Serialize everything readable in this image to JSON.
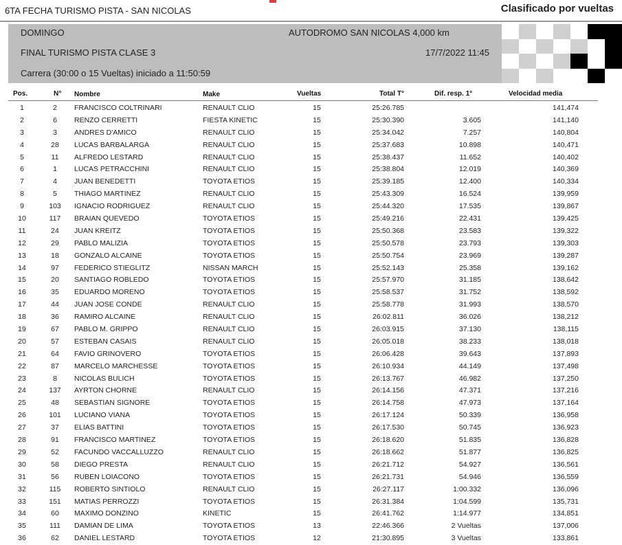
{
  "header": {
    "event_title": "6TA FECHA TURISMO PISTA - SAN NICOLAS",
    "classification": "Clasificado por vueltas"
  },
  "info": {
    "day": "DOMINGO",
    "circuit": "AUTODROMO SAN NICOLAS 4,000 km",
    "session": "FINAL TURISMO PISTA CLASE 3",
    "datetime": "17/7/2022 11:45",
    "race_start": "Carrera (30:00 o 15 Vueltas) iniciado a 11:50:59"
  },
  "columns": {
    "pos": "Pos.",
    "num": "N°",
    "name": "Nombre",
    "make": "Make",
    "laps": "Vueltas",
    "total": "Total T°",
    "diff": "Dif. resp. 1°",
    "speed": "Velocidad media"
  },
  "rows": [
    {
      "pos": "1",
      "num": "2",
      "name": "FRANCISCO COLTRINARI",
      "make": "RENAULT CLIO",
      "laps": "15",
      "total": "25:26.785",
      "diff": "",
      "speed": "141,474"
    },
    {
      "pos": "2",
      "num": "6",
      "name": "RENZO CERRETTI",
      "make": "FIESTA KINETIC",
      "laps": "15",
      "total": "25:30.390",
      "diff": "3.605",
      "speed": "141,140"
    },
    {
      "pos": "3",
      "num": "3",
      "name": "ANDRES D'AMICO",
      "make": "RENAULT CLIO",
      "laps": "15",
      "total": "25:34.042",
      "diff": "7.257",
      "speed": "140,804"
    },
    {
      "pos": "4",
      "num": "28",
      "name": "LUCAS BARBALARGA",
      "make": "RENAULT CLIO",
      "laps": "15",
      "total": "25:37.683",
      "diff": "10.898",
      "speed": "140,471"
    },
    {
      "pos": "5",
      "num": "11",
      "name": "ALFREDO LESTARD",
      "make": "RENAULT CLIO",
      "laps": "15",
      "total": "25:38.437",
      "diff": "11.652",
      "speed": "140,402"
    },
    {
      "pos": "6",
      "num": "1",
      "name": "LUCAS PETRACCHINI",
      "make": "RENAULT CLIO",
      "laps": "15",
      "total": "25:38.804",
      "diff": "12.019",
      "speed": "140,369"
    },
    {
      "pos": "7",
      "num": "4",
      "name": "JUAN BENEDETTI",
      "make": "TOYOTA ETIOS",
      "laps": "15",
      "total": "25:39.185",
      "diff": "12.400",
      "speed": "140,334"
    },
    {
      "pos": "8",
      "num": "5",
      "name": "THIAGO MARTINEZ",
      "make": "RENAULT CLIO",
      "laps": "15",
      "total": "25:43.309",
      "diff": "16.524",
      "speed": "139,959"
    },
    {
      "pos": "9",
      "num": "103",
      "name": "IGNACIO RODRIGUEZ",
      "make": "RENAULT CLIO",
      "laps": "15",
      "total": "25:44.320",
      "diff": "17.535",
      "speed": "139,867"
    },
    {
      "pos": "10",
      "num": "117",
      "name": "BRAIAN QUEVEDO",
      "make": "TOYOTA ETIOS",
      "laps": "15",
      "total": "25:49.216",
      "diff": "22.431",
      "speed": "139,425"
    },
    {
      "pos": "11",
      "num": "24",
      "name": "JUAN KREITZ",
      "make": "TOYOTA ETIOS",
      "laps": "15",
      "total": "25:50.368",
      "diff": "23.583",
      "speed": "139,322"
    },
    {
      "pos": "12",
      "num": "29",
      "name": "PABLO MALIZIA",
      "make": "TOYOTA ETIOS",
      "laps": "15",
      "total": "25:50.578",
      "diff": "23.793",
      "speed": "139,303"
    },
    {
      "pos": "13",
      "num": "18",
      "name": "GONZALO ALCAINE",
      "make": "TOYOTA ETIOS",
      "laps": "15",
      "total": "25:50.754",
      "diff": "23.969",
      "speed": "139,287"
    },
    {
      "pos": "14",
      "num": "97",
      "name": "FEDERICO STIEGLITZ",
      "make": "NISSAN MARCH",
      "laps": "15",
      "total": "25:52.143",
      "diff": "25.358",
      "speed": "139,162"
    },
    {
      "pos": "15",
      "num": "20",
      "name": "SANTIAGO ROBLEDO",
      "make": "TOYOTA ETIOS",
      "laps": "15",
      "total": "25:57.970",
      "diff": "31.185",
      "speed": "138,642"
    },
    {
      "pos": "16",
      "num": "35",
      "name": "EDUARDO MORENO",
      "make": "TOYOTA ETIOS",
      "laps": "15",
      "total": "25:58.537",
      "diff": "31.752",
      "speed": "138,592"
    },
    {
      "pos": "17",
      "num": "44",
      "name": "JUAN JOSE CONDE",
      "make": "RENAULT CLIO",
      "laps": "15",
      "total": "25:58.778",
      "diff": "31.993",
      "speed": "138,570"
    },
    {
      "pos": "18",
      "num": "36",
      "name": "RAMIRO ALCAINE",
      "make": "RENAULT CLIO",
      "laps": "15",
      "total": "26:02.811",
      "diff": "36.026",
      "speed": "138,212"
    },
    {
      "pos": "19",
      "num": "67",
      "name": "PABLO M. GRIPPO",
      "make": "RENAULT CLIO",
      "laps": "15",
      "total": "26:03.915",
      "diff": "37.130",
      "speed": "138,115"
    },
    {
      "pos": "20",
      "num": "57",
      "name": "ESTEBAN CASAIS",
      "make": "RENAULT CLIO",
      "laps": "15",
      "total": "26:05.018",
      "diff": "38.233",
      "speed": "138,018"
    },
    {
      "pos": "21",
      "num": "64",
      "name": "FAVIO GRINOVERO",
      "make": "TOYOTA ETIOS",
      "laps": "15",
      "total": "26:06.428",
      "diff": "39.643",
      "speed": "137,893"
    },
    {
      "pos": "22",
      "num": "87",
      "name": "MARCELO MARCHESSE",
      "make": "TOYOTA ETIOS",
      "laps": "15",
      "total": "26:10.934",
      "diff": "44.149",
      "speed": "137,498"
    },
    {
      "pos": "23",
      "num": "8",
      "name": "NICOLAS BULICH",
      "make": "TOYOTA ETIOS",
      "laps": "15",
      "total": "26:13.767",
      "diff": "46.982",
      "speed": "137,250"
    },
    {
      "pos": "24",
      "num": "137",
      "name": "AYRTON CHORNE",
      "make": "RENAULT CLIO",
      "laps": "15",
      "total": "26:14.156",
      "diff": "47.371",
      "speed": "137,216"
    },
    {
      "pos": "25",
      "num": "48",
      "name": "SEBASTIAN SIGNORE",
      "make": "TOYOTA ETIOS",
      "laps": "15",
      "total": "26:14.758",
      "diff": "47.973",
      "speed": "137,164"
    },
    {
      "pos": "26",
      "num": "101",
      "name": "LUCIANO VIANA",
      "make": "TOYOTA ETIOS",
      "laps": "15",
      "total": "26:17.124",
      "diff": "50.339",
      "speed": "136,958"
    },
    {
      "pos": "27",
      "num": "37",
      "name": "ELIAS BATTINI",
      "make": "TOYOTA ETIOS",
      "laps": "15",
      "total": "26:17.530",
      "diff": "50.745",
      "speed": "136,923"
    },
    {
      "pos": "28",
      "num": "91",
      "name": "FRANCISCO MARTINEZ",
      "make": "TOYOTA ETIOS",
      "laps": "15",
      "total": "26:18.620",
      "diff": "51.835",
      "speed": "136,828"
    },
    {
      "pos": "29",
      "num": "52",
      "name": "FACUNDO VACCALLUZZO",
      "make": "RENAULT CLIO",
      "laps": "15",
      "total": "26:18.662",
      "diff": "51.877",
      "speed": "136,825"
    },
    {
      "pos": "30",
      "num": "58",
      "name": "DIEGO PRESTA",
      "make": "RENAULT CLIO",
      "laps": "15",
      "total": "26:21.712",
      "diff": "54.927",
      "speed": "136,561"
    },
    {
      "pos": "31",
      "num": "56",
      "name": "RUBEN LOIACONO",
      "make": "TOYOTA ETIOS",
      "laps": "15",
      "total": "26:21.731",
      "diff": "54.946",
      "speed": "136,559"
    },
    {
      "pos": "32",
      "num": "115",
      "name": "ROBERTO SINTIOLO",
      "make": "RENAULT CLIO",
      "laps": "15",
      "total": "26:27.117",
      "diff": "1:00.332",
      "speed": "136,096"
    },
    {
      "pos": "33",
      "num": "151",
      "name": "MATIAS PERROZZI",
      "make": "TOYOTA ETIOS",
      "laps": "15",
      "total": "26:31.384",
      "diff": "1:04.599",
      "speed": "135,731"
    },
    {
      "pos": "34",
      "num": "60",
      "name": "MAXIMO DONZINO",
      "make": "KINETIC",
      "laps": "15",
      "total": "26:41.762",
      "diff": "1:14.977",
      "speed": "134,851"
    },
    {
      "pos": "35",
      "num": "111",
      "name": "DAMIAN DE LIMA",
      "make": "TOYOTA ETIOS",
      "laps": "13",
      "total": "22:46.366",
      "diff": "2 Vueltas",
      "speed": "137,006"
    },
    {
      "pos": "36",
      "num": "62",
      "name": "DANIEL LESTARD",
      "make": "TOYOTA ETIOS",
      "laps": "12",
      "total": "21:30.895",
      "diff": "3 Vueltas",
      "speed": "133,861"
    }
  ]
}
